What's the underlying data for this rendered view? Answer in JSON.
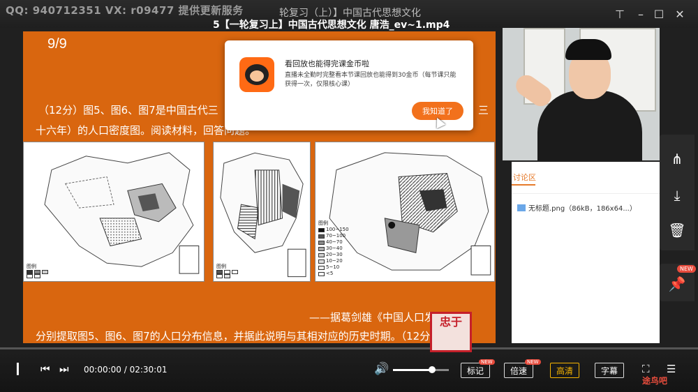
{
  "topbar": {
    "watermark": "QQ: 940712351 VX: r09477 提供更新服务",
    "topic": "轮复习（上）】中国古代思想文化",
    "filename": "5【一轮复习上】中国古代思想文化 唐浩_ev~1.mp4"
  },
  "slide": {
    "page": "9/9",
    "question_line1": "（12分）图5、图6、图7是中国古代三",
    "question_line1_tail": "三",
    "question_line2": "十六年）的人口密度图。阅读材料，回答问题。",
    "citation": "——据葛剑雄《中国人口发展史》",
    "question2": "分别提取图5、图6、图7的人口分布信息，并据此说明与其相对应的历史时期。（12分）",
    "map1_legend_title": "图例",
    "map2_legend_title": "图例",
    "map3_legend_title": "图例",
    "map3_legend_items": [
      "100~150",
      "70~100",
      "40~70",
      "30~40",
      "20~30",
      "10~20",
      "5~10",
      "<5"
    ]
  },
  "popup": {
    "title": "看回放也能得完课金币啦",
    "body": "直播未全勤时完整看本节课回放也能得到30金币（每节课只能获得一次，仅限核心课）",
    "button": "我知道了"
  },
  "notes": {
    "tab": "讨论区",
    "item": "无标题.png（86kB，186x64...）"
  },
  "sidebar": {
    "pin_badge": "NEW"
  },
  "controls": {
    "time": "00:00:00 / 02:30:01",
    "buttons": {
      "mark": "标记",
      "speed": "倍速",
      "quality": "高清",
      "subtitle": "字幕"
    },
    "mark_badge": "NEW",
    "speed_badge": "NEW",
    "volume": 0.7,
    "progress": 0
  },
  "stamp": "忠于",
  "site_logo": "途鸟吧",
  "colors": {
    "slide_bg": "#d9660f",
    "accent_orange": "#f2711c",
    "highlight": "#f7b500"
  }
}
